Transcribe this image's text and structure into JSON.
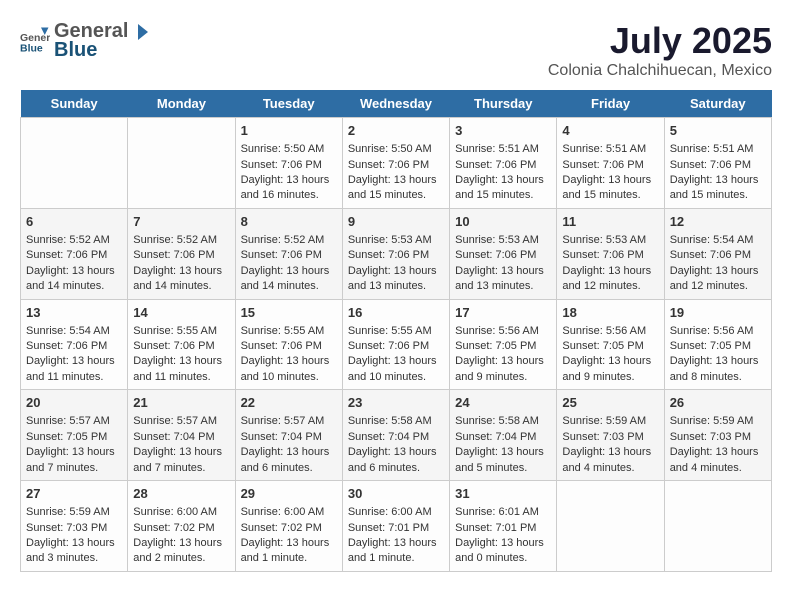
{
  "header": {
    "logo_general": "General",
    "logo_blue": "Blue",
    "title": "July 2025",
    "subtitle": "Colonia Chalchihuecan, Mexico"
  },
  "days_of_week": [
    "Sunday",
    "Monday",
    "Tuesday",
    "Wednesday",
    "Thursday",
    "Friday",
    "Saturday"
  ],
  "weeks": [
    [
      {
        "day": "",
        "content": ""
      },
      {
        "day": "",
        "content": ""
      },
      {
        "day": "1",
        "content": "Sunrise: 5:50 AM\nSunset: 7:06 PM\nDaylight: 13 hours and 16 minutes."
      },
      {
        "day": "2",
        "content": "Sunrise: 5:50 AM\nSunset: 7:06 PM\nDaylight: 13 hours and 15 minutes."
      },
      {
        "day": "3",
        "content": "Sunrise: 5:51 AM\nSunset: 7:06 PM\nDaylight: 13 hours and 15 minutes."
      },
      {
        "day": "4",
        "content": "Sunrise: 5:51 AM\nSunset: 7:06 PM\nDaylight: 13 hours and 15 minutes."
      },
      {
        "day": "5",
        "content": "Sunrise: 5:51 AM\nSunset: 7:06 PM\nDaylight: 13 hours and 15 minutes."
      }
    ],
    [
      {
        "day": "6",
        "content": "Sunrise: 5:52 AM\nSunset: 7:06 PM\nDaylight: 13 hours and 14 minutes."
      },
      {
        "day": "7",
        "content": "Sunrise: 5:52 AM\nSunset: 7:06 PM\nDaylight: 13 hours and 14 minutes."
      },
      {
        "day": "8",
        "content": "Sunrise: 5:52 AM\nSunset: 7:06 PM\nDaylight: 13 hours and 14 minutes."
      },
      {
        "day": "9",
        "content": "Sunrise: 5:53 AM\nSunset: 7:06 PM\nDaylight: 13 hours and 13 minutes."
      },
      {
        "day": "10",
        "content": "Sunrise: 5:53 AM\nSunset: 7:06 PM\nDaylight: 13 hours and 13 minutes."
      },
      {
        "day": "11",
        "content": "Sunrise: 5:53 AM\nSunset: 7:06 PM\nDaylight: 13 hours and 12 minutes."
      },
      {
        "day": "12",
        "content": "Sunrise: 5:54 AM\nSunset: 7:06 PM\nDaylight: 13 hours and 12 minutes."
      }
    ],
    [
      {
        "day": "13",
        "content": "Sunrise: 5:54 AM\nSunset: 7:06 PM\nDaylight: 13 hours and 11 minutes."
      },
      {
        "day": "14",
        "content": "Sunrise: 5:55 AM\nSunset: 7:06 PM\nDaylight: 13 hours and 11 minutes."
      },
      {
        "day": "15",
        "content": "Sunrise: 5:55 AM\nSunset: 7:06 PM\nDaylight: 13 hours and 10 minutes."
      },
      {
        "day": "16",
        "content": "Sunrise: 5:55 AM\nSunset: 7:06 PM\nDaylight: 13 hours and 10 minutes."
      },
      {
        "day": "17",
        "content": "Sunrise: 5:56 AM\nSunset: 7:05 PM\nDaylight: 13 hours and 9 minutes."
      },
      {
        "day": "18",
        "content": "Sunrise: 5:56 AM\nSunset: 7:05 PM\nDaylight: 13 hours and 9 minutes."
      },
      {
        "day": "19",
        "content": "Sunrise: 5:56 AM\nSunset: 7:05 PM\nDaylight: 13 hours and 8 minutes."
      }
    ],
    [
      {
        "day": "20",
        "content": "Sunrise: 5:57 AM\nSunset: 7:05 PM\nDaylight: 13 hours and 7 minutes."
      },
      {
        "day": "21",
        "content": "Sunrise: 5:57 AM\nSunset: 7:04 PM\nDaylight: 13 hours and 7 minutes."
      },
      {
        "day": "22",
        "content": "Sunrise: 5:57 AM\nSunset: 7:04 PM\nDaylight: 13 hours and 6 minutes."
      },
      {
        "day": "23",
        "content": "Sunrise: 5:58 AM\nSunset: 7:04 PM\nDaylight: 13 hours and 6 minutes."
      },
      {
        "day": "24",
        "content": "Sunrise: 5:58 AM\nSunset: 7:04 PM\nDaylight: 13 hours and 5 minutes."
      },
      {
        "day": "25",
        "content": "Sunrise: 5:59 AM\nSunset: 7:03 PM\nDaylight: 13 hours and 4 minutes."
      },
      {
        "day": "26",
        "content": "Sunrise: 5:59 AM\nSunset: 7:03 PM\nDaylight: 13 hours and 4 minutes."
      }
    ],
    [
      {
        "day": "27",
        "content": "Sunrise: 5:59 AM\nSunset: 7:03 PM\nDaylight: 13 hours and 3 minutes."
      },
      {
        "day": "28",
        "content": "Sunrise: 6:00 AM\nSunset: 7:02 PM\nDaylight: 13 hours and 2 minutes."
      },
      {
        "day": "29",
        "content": "Sunrise: 6:00 AM\nSunset: 7:02 PM\nDaylight: 13 hours and 1 minute."
      },
      {
        "day": "30",
        "content": "Sunrise: 6:00 AM\nSunset: 7:01 PM\nDaylight: 13 hours and 1 minute."
      },
      {
        "day": "31",
        "content": "Sunrise: 6:01 AM\nSunset: 7:01 PM\nDaylight: 13 hours and 0 minutes."
      },
      {
        "day": "",
        "content": ""
      },
      {
        "day": "",
        "content": ""
      }
    ]
  ]
}
